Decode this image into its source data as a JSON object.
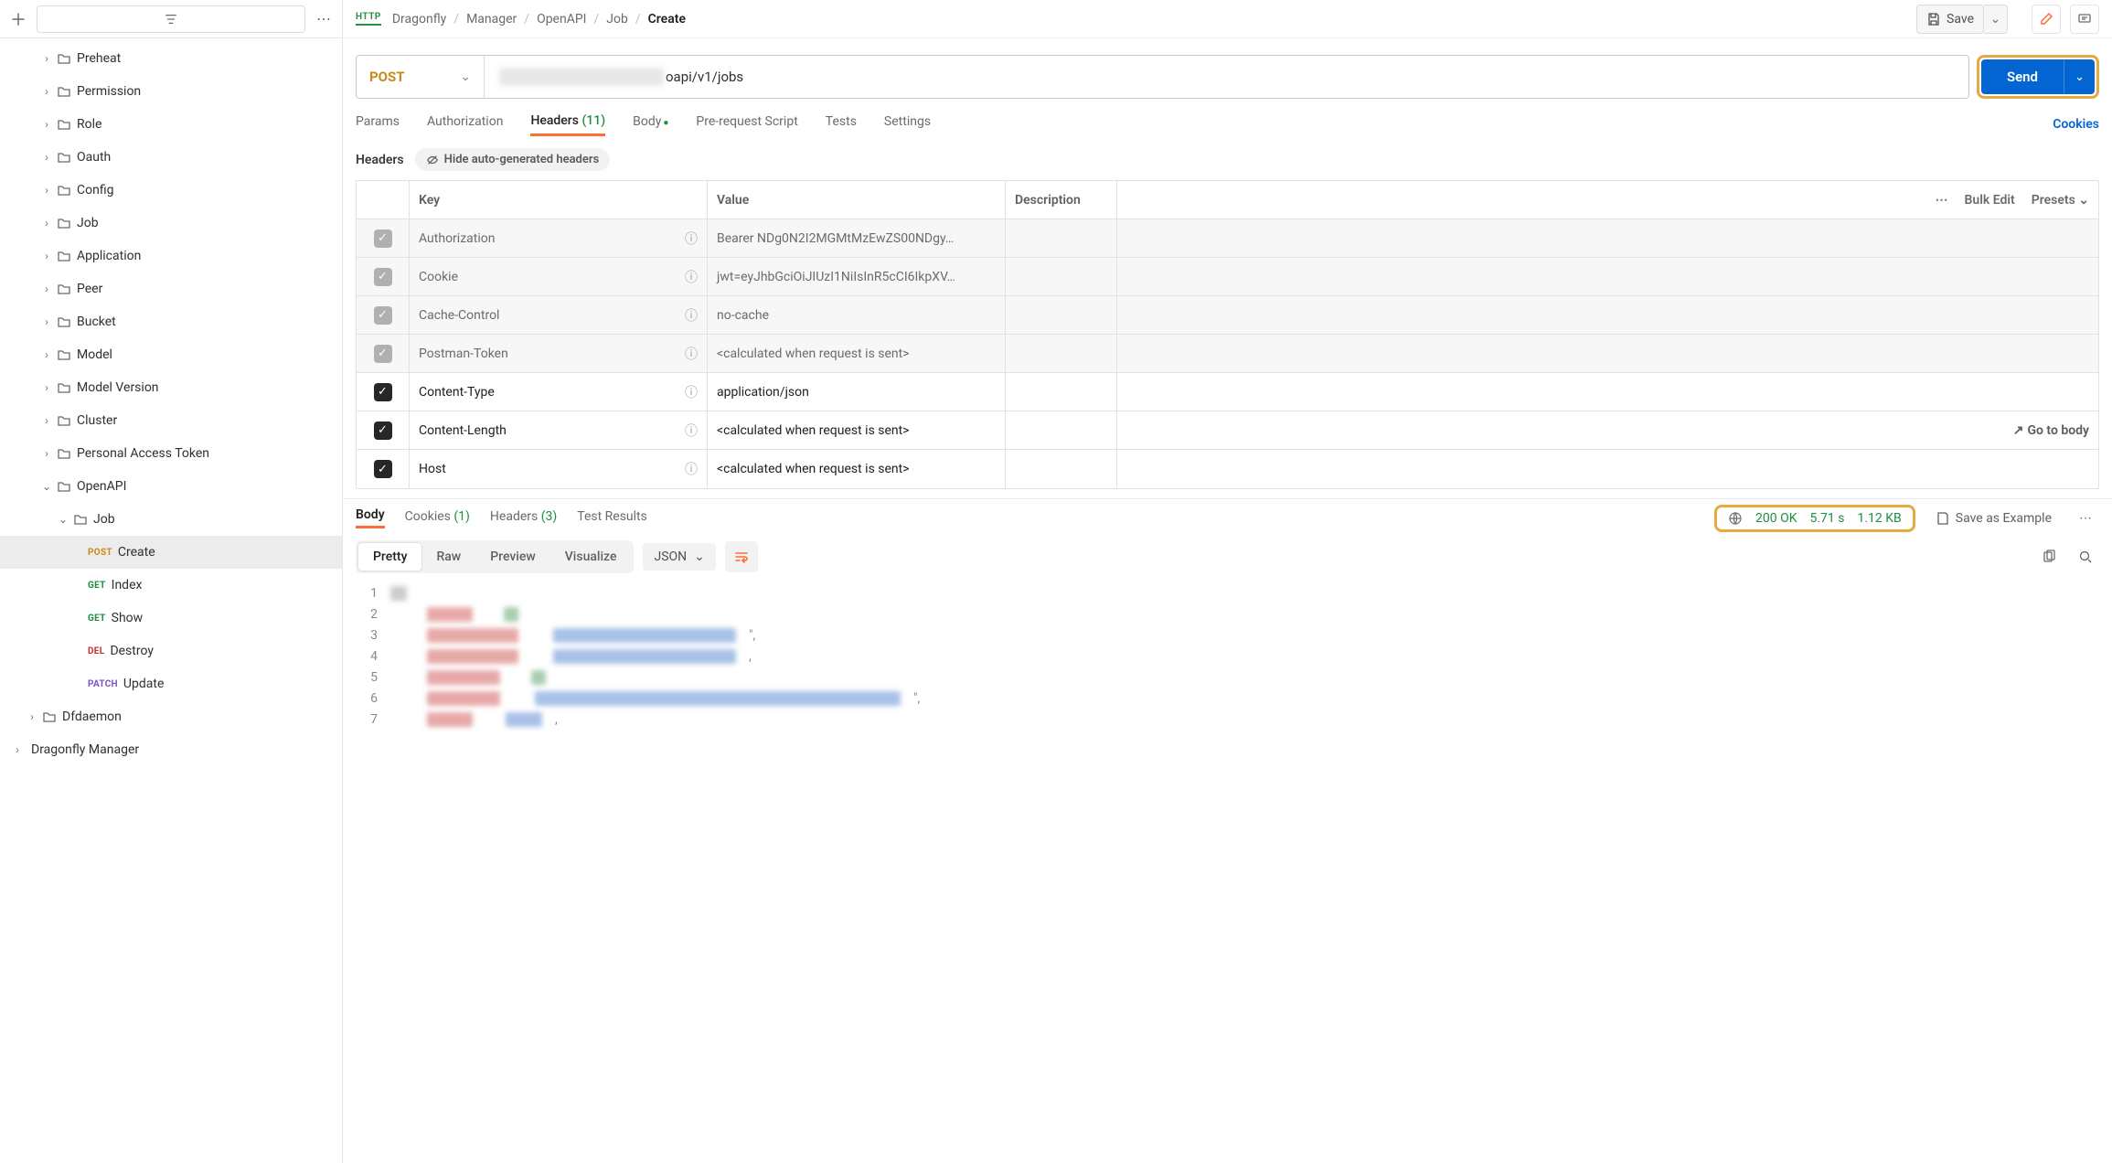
{
  "sidebar": {
    "folders": [
      {
        "name": "Preheat"
      },
      {
        "name": "Permission"
      },
      {
        "name": "Role"
      },
      {
        "name": "Oauth"
      },
      {
        "name": "Config"
      },
      {
        "name": "Job"
      },
      {
        "name": "Application"
      },
      {
        "name": "Peer"
      },
      {
        "name": "Bucket"
      },
      {
        "name": "Model"
      },
      {
        "name": "Model Version"
      },
      {
        "name": "Cluster"
      },
      {
        "name": "Personal Access Token"
      }
    ],
    "openapi_label": "OpenAPI",
    "job_label": "Job",
    "job_children": [
      {
        "method": "POST",
        "label": "Create",
        "selected": true
      },
      {
        "method": "GET",
        "label": "Index"
      },
      {
        "method": "GET",
        "label": "Show"
      },
      {
        "method": "DEL",
        "label": "Destroy"
      },
      {
        "method": "PATCH",
        "label": "Update"
      }
    ],
    "dfdaemon": "Dfdaemon",
    "dragonfly_manager": "Dragonfly Manager"
  },
  "breadcrumb": [
    "Dragonfly",
    "Manager",
    "OpenAPI",
    "Job",
    "Create"
  ],
  "top": {
    "save_label": "Save",
    "http_tag": "HTTP"
  },
  "request": {
    "method": "POST",
    "url_suffix": "oapi/v1/jobs",
    "send_label": "Send"
  },
  "tabs": {
    "params": "Params",
    "authorization": "Authorization",
    "headers": "Headers",
    "headers_count": "(11)",
    "body": "Body",
    "prerequest": "Pre-request Script",
    "tests": "Tests",
    "settings": "Settings",
    "cookies": "Cookies"
  },
  "headers_section": {
    "label": "Headers",
    "hide_label": "Hide auto-generated headers",
    "columns": {
      "key": "Key",
      "value": "Value",
      "description": "Description",
      "bulk": "Bulk Edit",
      "presets": "Presets"
    },
    "rows": [
      {
        "muted": true,
        "key": "Authorization",
        "value": "Bearer NDg0N2I2MGMtMzEwZS00NDgy…"
      },
      {
        "muted": true,
        "key": "Cookie",
        "value": "jwt=eyJhbGciOiJIUzI1NiIsInR5cCI6IkpXV…"
      },
      {
        "muted": true,
        "key": "Cache-Control",
        "value": "no-cache"
      },
      {
        "muted": true,
        "key": "Postman-Token",
        "value": "<calculated when request is sent>"
      },
      {
        "muted": false,
        "key": "Content-Type",
        "value": "application/json"
      },
      {
        "muted": false,
        "key": "Content-Length",
        "value": "<calculated when request is sent>",
        "goto_body": "Go to body"
      },
      {
        "muted": false,
        "key": "Host",
        "value": "<calculated when request is sent>"
      }
    ]
  },
  "response": {
    "tabs": {
      "body": "Body",
      "cookies": "Cookies",
      "cookies_count": "(1)",
      "headers": "Headers",
      "headers_count": "(3)",
      "test_results": "Test Results"
    },
    "status_code": "200 OK",
    "time": "5.71 s",
    "size": "1.12 KB",
    "save_example": "Save as Example",
    "views": {
      "pretty": "Pretty",
      "raw": "Raw",
      "preview": "Preview",
      "visualize": "Visualize"
    },
    "format": "JSON",
    "line_numbers": [
      "1",
      "2",
      "3",
      "4",
      "5",
      "6",
      "7"
    ]
  }
}
